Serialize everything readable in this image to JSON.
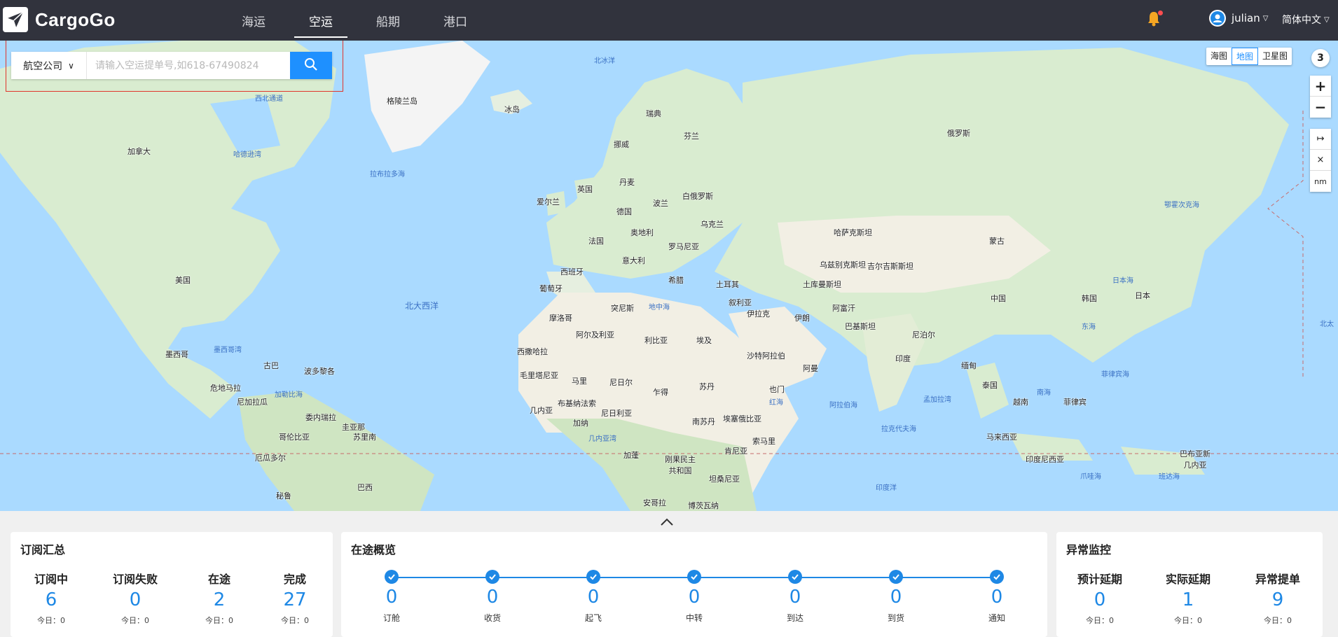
{
  "app": {
    "brand": "CargoGo"
  },
  "nav": [
    {
      "label": "海运",
      "active": false
    },
    {
      "label": "空运",
      "active": true
    },
    {
      "label": "船期",
      "active": false
    },
    {
      "label": "港口",
      "active": false
    }
  ],
  "user": {
    "name": "julian",
    "language": "简体中文"
  },
  "search": {
    "airline_label": "航空公司",
    "placeholder": "请输入空运提单号,如618-67490824"
  },
  "map_controls": {
    "types": [
      "海图",
      "地图",
      "卫星图"
    ],
    "active_type": "地图",
    "count": "3",
    "zoom_in": "+",
    "zoom_out": "−",
    "measure": "↦",
    "clear": "×",
    "unit": "nm"
  },
  "map_labels": {
    "oceans": [
      "北大西洋",
      "印度洋",
      "哈德逊湾",
      "拉布拉多海",
      "墨西哥湾",
      "加勒比海",
      "地中海",
      "阿拉伯海",
      "孟加拉湾",
      "红海",
      "几内亚湾",
      "日本海",
      "东海",
      "南海",
      "菲律宾海",
      "鄂霍次克海",
      "北冰洋",
      "爪哇海",
      "班达海",
      "西北通道",
      "拉克代夫海",
      "北太"
    ],
    "countries": [
      "格陵兰岛",
      "冰岛",
      "加拿大",
      "美国",
      "墨西哥",
      "古巴",
      "危地马拉",
      "尼加拉瓜",
      "委内瑞拉",
      "圭亚那",
      "苏里南",
      "哥伦比亚",
      "厄瓜多尔",
      "秘鲁",
      "巴西",
      "波多黎各",
      "瑞典",
      "芬兰",
      "挪威",
      "丹麦",
      "英国",
      "爱尔兰",
      "德国",
      "波兰",
      "白俄罗斯",
      "乌克兰",
      "法国",
      "奥地利",
      "罗马尼亚",
      "意大利",
      "西班牙",
      "葡萄牙",
      "希腊",
      "土耳其",
      "俄罗斯",
      "哈萨克斯坦",
      "蒙古",
      "中国",
      "日本",
      "韩国",
      "乌兹别克斯坦",
      "吉尔吉斯斯坦",
      "土库曼斯坦",
      "阿富汗",
      "巴基斯坦",
      "印度",
      "尼泊尔",
      "缅甸",
      "泰国",
      "越南",
      "菲律宾",
      "马来西亚",
      "印度尼西亚",
      "巴布亚新几内亚",
      "伊朗",
      "伊拉克",
      "叙利亚",
      "沙特阿拉伯",
      "阿曼",
      "也门",
      "埃及",
      "利比亚",
      "阿尔及利亚",
      "突尼斯",
      "摩洛哥",
      "西撒哈拉",
      "毛里塔尼亚",
      "马里",
      "尼日尔",
      "乍得",
      "苏丹",
      "南苏丹",
      "埃塞俄比亚",
      "索马里",
      "肯尼亚",
      "坦桑尼亚",
      "尼日利亚",
      "布基纳法索",
      "几内亚",
      "加纳",
      "加蓬",
      "刚果民主共和国",
      "安哥拉",
      "博茨瓦纳"
    ]
  },
  "subscription": {
    "title": "订阅汇总",
    "stats": [
      {
        "label": "订阅中",
        "value": "6",
        "today": "今日：0"
      },
      {
        "label": "订阅失败",
        "value": "0",
        "today": "今日：0"
      },
      {
        "label": "在途",
        "value": "2",
        "today": "今日：0"
      },
      {
        "label": "完成",
        "value": "27",
        "today": "今日：0"
      }
    ]
  },
  "transit": {
    "title": "在途概览",
    "steps": [
      {
        "label": "订舱",
        "value": "0"
      },
      {
        "label": "收货",
        "value": "0"
      },
      {
        "label": "起飞",
        "value": "0"
      },
      {
        "label": "中转",
        "value": "0"
      },
      {
        "label": "到达",
        "value": "0"
      },
      {
        "label": "到货",
        "value": "0"
      },
      {
        "label": "通知",
        "value": "0"
      }
    ]
  },
  "anomaly": {
    "title": "异常监控",
    "stats": [
      {
        "label": "预计延期",
        "value": "0",
        "today": "今日：0"
      },
      {
        "label": "实际延期",
        "value": "1",
        "today": "今日：0"
      },
      {
        "label": "异常提单",
        "value": "9",
        "today": "今日：0"
      }
    ]
  },
  "colors": {
    "topbar": "#31333d",
    "accent": "#1e88e5",
    "ocean": "#aadaff",
    "land": "#d9ecd0",
    "desert": "#f2efe4",
    "highlight_border": "#e0352b"
  }
}
